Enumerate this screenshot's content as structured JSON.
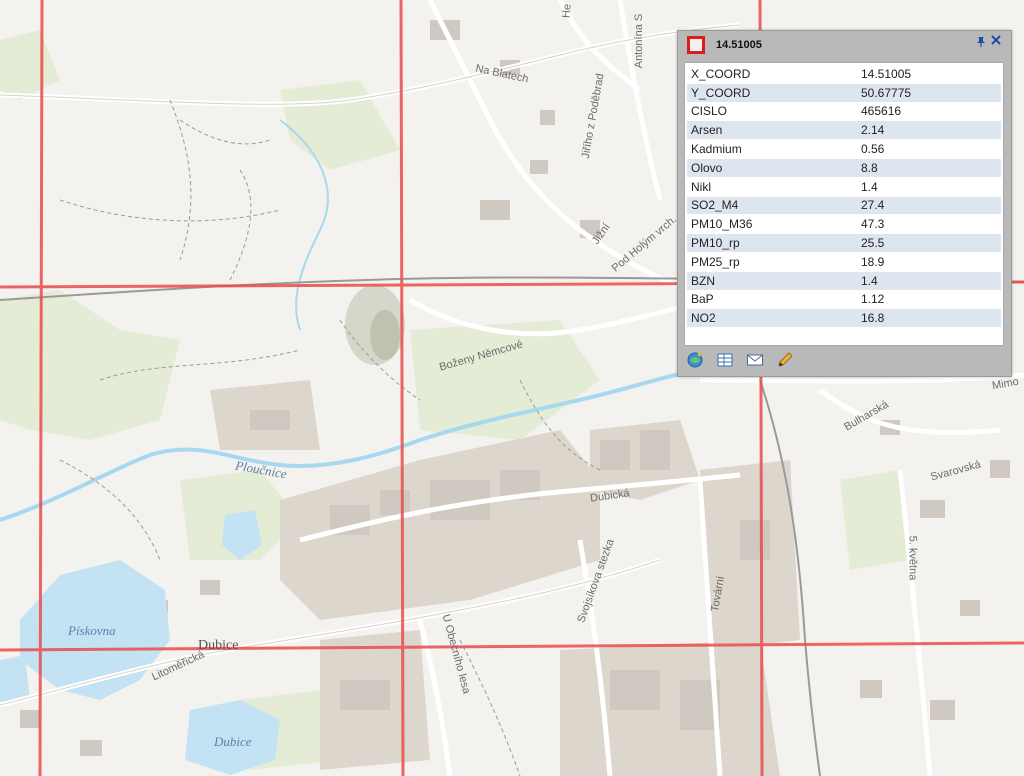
{
  "popup": {
    "title": "14.51005",
    "rows": [
      {
        "key": "X_COORD",
        "value": "14.51005"
      },
      {
        "key": "Y_COORD",
        "value": "50.67775"
      },
      {
        "key": "CISLO",
        "value": "465616"
      },
      {
        "key": "Arsen",
        "value": "2.14"
      },
      {
        "key": "Kadmium",
        "value": "0.56"
      },
      {
        "key": "Olovo",
        "value": "8.8"
      },
      {
        "key": "Nikl",
        "value": "1.4"
      },
      {
        "key": "SO2_M4",
        "value": "27.4"
      },
      {
        "key": "PM10_M36",
        "value": "47.3"
      },
      {
        "key": "PM10_rp",
        "value": "25.5"
      },
      {
        "key": "PM25_rp",
        "value": "18.9"
      },
      {
        "key": "BZN",
        "value": "1.4"
      },
      {
        "key": "BaP",
        "value": "1.12"
      },
      {
        "key": "NO2",
        "value": "16.8"
      }
    ],
    "tools": [
      "zoom-to-icon",
      "attribute-table-icon",
      "email-icon",
      "edit-pencil-icon"
    ],
    "pin_icon": "pin-icon",
    "close_icon": "close-icon"
  },
  "map": {
    "labels": {
      "na_blatech": "Na Blatech",
      "antonina": "Antonína S",
      "jiriho": "Jiřího z Poděbrad",
      "jizni": "Jižní",
      "pod_holym": "Pod Holým vrch.",
      "bozeny": "Boženy Němcové",
      "mimo": "Mimo",
      "bulharska": "Bulharská",
      "svarovska": "Svarovská",
      "dubicka": "Dubická",
      "petvkvetna": "5. května",
      "tovarni": "Tovární",
      "svojsikova": "Svojsíkova stezka",
      "u_obecniho": "U Obecního lesa",
      "litomericka": "Litoměřická",
      "he": "He"
    },
    "water_labels": {
      "ploucnice": "Ploučnice",
      "piskovna": "Pískovna",
      "dubice_lake": "Dubice"
    },
    "town": "Dubice",
    "colors": {
      "background": "#f4f2ee",
      "water": "#c3e3f5",
      "river": "#a8d8f0",
      "grid": "#ea4c4c",
      "industrial": "#ddd6cd",
      "green": "#e4ecd5",
      "building": "#cfc9c2"
    }
  }
}
